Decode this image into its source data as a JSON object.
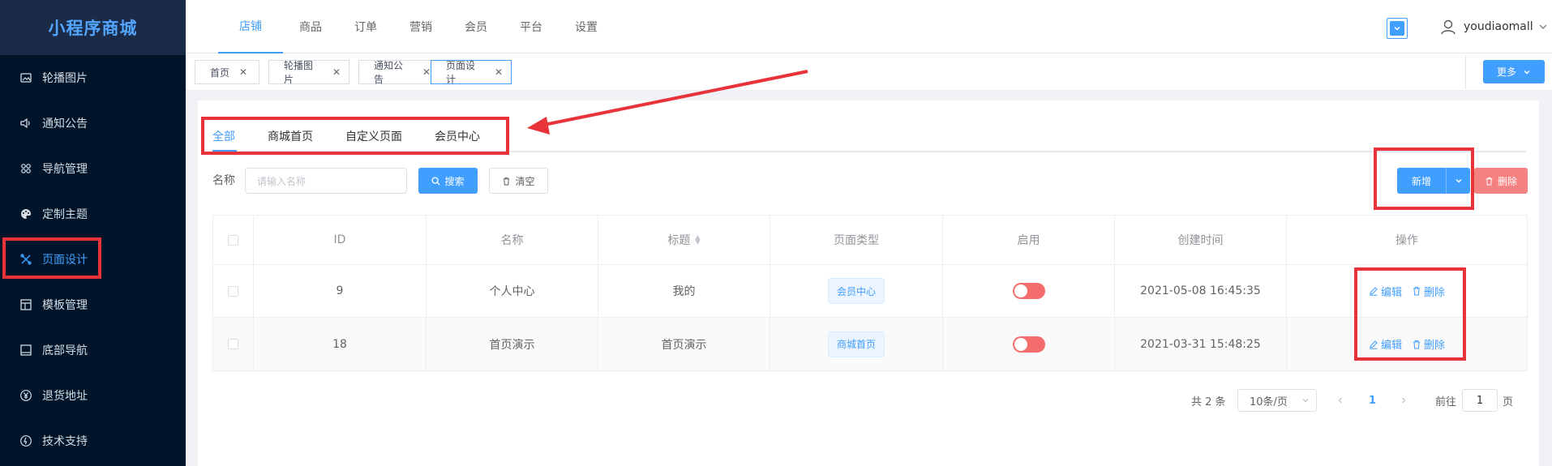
{
  "brand": {
    "title": "小程序商城"
  },
  "sidebar": {
    "items": [
      {
        "label": "轮播图片",
        "icon": "image-icon",
        "active": false
      },
      {
        "label": "通知公告",
        "icon": "speaker-icon",
        "active": false
      },
      {
        "label": "导航管理",
        "icon": "grid-icon",
        "active": false
      },
      {
        "label": "定制主题",
        "icon": "palette-icon",
        "active": false
      },
      {
        "label": "页面设计",
        "icon": "design-icon",
        "active": true
      },
      {
        "label": "模板管理",
        "icon": "template-icon",
        "active": false
      },
      {
        "label": "底部导航",
        "icon": "bottom-nav-icon",
        "active": false
      },
      {
        "label": "退货地址",
        "icon": "yen-icon",
        "active": false
      },
      {
        "label": "技术支持",
        "icon": "support-icon",
        "active": false
      }
    ]
  },
  "topnav": {
    "items": [
      "店铺",
      "商品",
      "订单",
      "营销",
      "会员",
      "平台",
      "设置"
    ],
    "active": "店铺",
    "username": "youdiaomall"
  },
  "tagsbar": {
    "tags": [
      "首页",
      "轮播图片",
      "通知公告",
      "页面设计"
    ],
    "active": "页面设计",
    "more_label": "更多"
  },
  "subtabs": {
    "items": [
      "全部",
      "商城首页",
      "自定义页面",
      "会员中心"
    ],
    "active": "全部"
  },
  "filter": {
    "name_label": "名称",
    "name_placeholder": "请输入名称",
    "search_label": "搜索",
    "clear_label": "清空",
    "add_label": "新增",
    "delete_label": "删除"
  },
  "table": {
    "columns": [
      "ID",
      "名称",
      "标题",
      "页面类型",
      "启用",
      "创建时间",
      "操作"
    ],
    "rows": [
      {
        "id": "9",
        "name": "个人中心",
        "title": "我的",
        "type": "会员中心",
        "enabled": false,
        "created": "2021-05-08 16:45:35"
      },
      {
        "id": "18",
        "name": "首页演示",
        "title": "首页演示",
        "type": "商城首页",
        "enabled": false,
        "created": "2021-03-31 15:48:25"
      }
    ],
    "edit_label": "编辑",
    "delete_label": "删除"
  },
  "pagination": {
    "total_text": "共 2 条",
    "page_size": "10条/页",
    "current_page": "1",
    "goto_label": "前往",
    "goto_value": "1",
    "page_unit": "页"
  },
  "colors": {
    "primary": "#409eff",
    "danger": "#f56c6c",
    "sidebar_bg": "#001529",
    "annotation": "#e8333b"
  }
}
